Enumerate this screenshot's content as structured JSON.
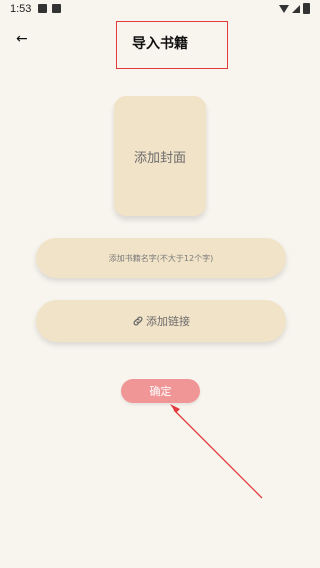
{
  "status": {
    "time": "1:53",
    "icons": [
      "gallery-icon",
      "notification-icon",
      "wifi-icon",
      "signal-icon",
      "battery-icon"
    ]
  },
  "header": {
    "back_icon": "back-arrow-icon",
    "title": "导入书籍"
  },
  "form": {
    "cover_label": "添加封面",
    "book_name_placeholder": "添加书籍名字(不大于12个字)",
    "link_icon": "link-icon",
    "link_label": "添加链接",
    "confirm_label": "确定"
  },
  "colors": {
    "background": "#f8f5ef",
    "card": "#f1e3c8",
    "confirm": "#f09696",
    "annotation": "#e23b3b"
  }
}
